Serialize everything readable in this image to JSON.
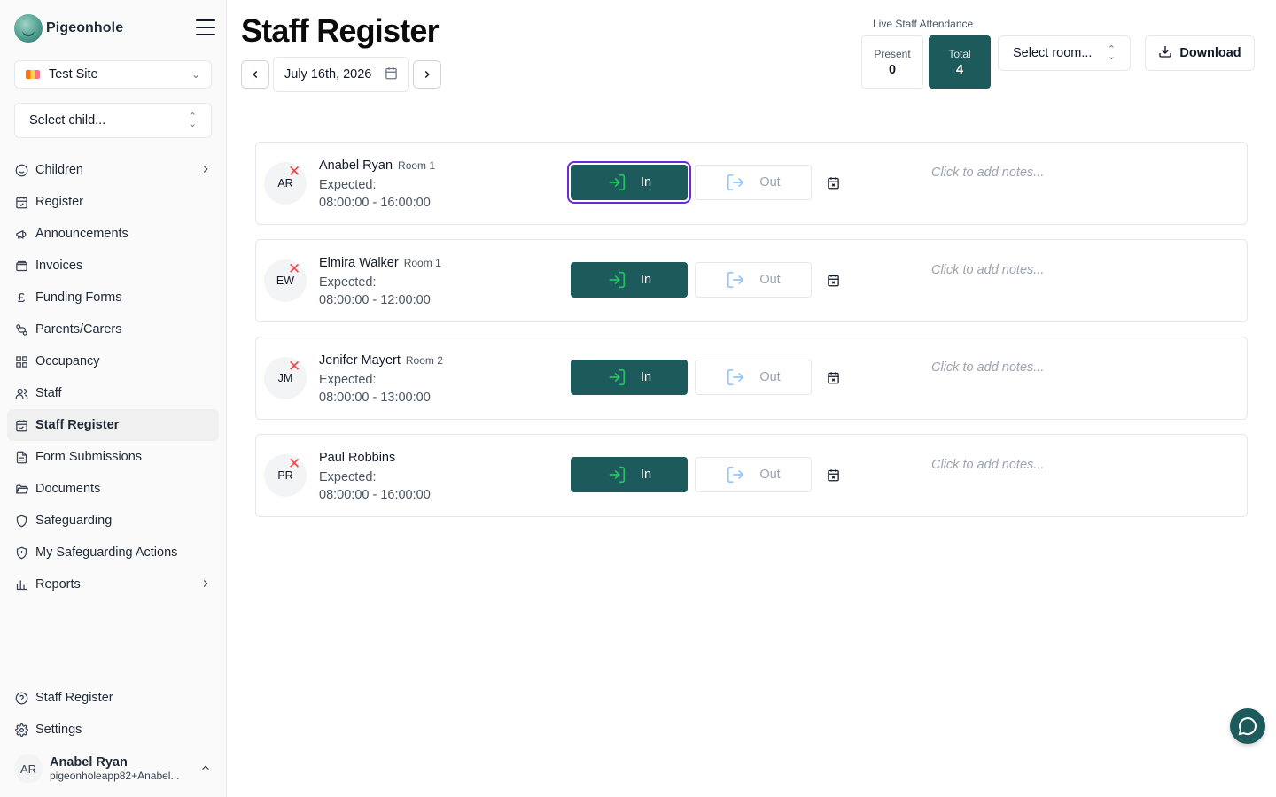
{
  "app": {
    "name": "Pigeonhole"
  },
  "sidebar": {
    "site": "Test Site",
    "child_placeholder": "Select child...",
    "items": [
      {
        "label": "Children"
      },
      {
        "label": "Register"
      },
      {
        "label": "Announcements"
      },
      {
        "label": "Invoices"
      },
      {
        "label": "Funding Forms"
      },
      {
        "label": "Parents/Carers"
      },
      {
        "label": "Occupancy"
      },
      {
        "label": "Staff"
      },
      {
        "label": "Staff Register"
      },
      {
        "label": "Form Submissions"
      },
      {
        "label": "Documents"
      },
      {
        "label": "Safeguarding"
      },
      {
        "label": "My Safeguarding Actions"
      },
      {
        "label": "Reports"
      }
    ],
    "bottom_items": [
      {
        "label": "Staff Register"
      },
      {
        "label": "Settings"
      }
    ],
    "user": {
      "initials": "AR",
      "name": "Anabel Ryan",
      "email": "pigeonholeapp82+Anabel..."
    }
  },
  "header": {
    "title": "Staff Register",
    "date": "July 16th, 2026",
    "live_label": "Live Staff Attendance",
    "present_label": "Present",
    "present_value": "0",
    "total_label": "Total",
    "total_value": "4",
    "room_placeholder": "Select room...",
    "download_label": "Download"
  },
  "staff": [
    {
      "initials": "AR",
      "name": "Anabel Ryan",
      "room": "Room 1",
      "expected_label": "Expected:",
      "expected": "08:00:00 - 16:00:00",
      "in_label": "In",
      "out_label": "Out",
      "notes_placeholder": "Click to add notes..."
    },
    {
      "initials": "EW",
      "name": "Elmira Walker",
      "room": "Room 1",
      "expected_label": "Expected:",
      "expected": "08:00:00 - 12:00:00",
      "in_label": "In",
      "out_label": "Out",
      "notes_placeholder": "Click to add notes..."
    },
    {
      "initials": "JM",
      "name": "Jenifer Mayert",
      "room": "Room 2",
      "expected_label": "Expected:",
      "expected": "08:00:00 - 13:00:00",
      "in_label": "In",
      "out_label": "Out",
      "notes_placeholder": "Click to add notes..."
    },
    {
      "initials": "PR",
      "name": "Paul Robbins",
      "room": "",
      "expected_label": "Expected:",
      "expected": "08:00:00 - 16:00:00",
      "in_label": "In",
      "out_label": "Out",
      "notes_placeholder": "Click to add notes..."
    }
  ],
  "colors": {
    "primary": "#1c5a5c",
    "in_arrow": "#22c55e",
    "out_arrow": "#93c5fd",
    "focus_ring": "#6d28d9",
    "absent_x": "#ef4444"
  }
}
